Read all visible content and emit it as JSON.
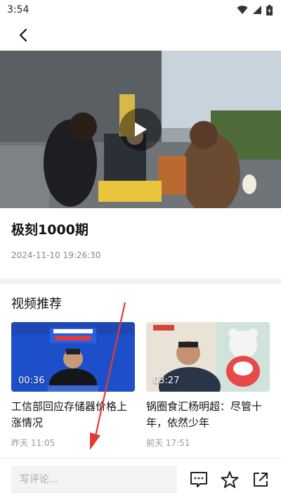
{
  "status_bar": {
    "time": "3:54"
  },
  "video": {
    "title": "极刻1000期",
    "published": "2024-11-10 19:26:30"
  },
  "recommend": {
    "section_title": "视频推荐",
    "items": [
      {
        "duration": "00:36",
        "title": "工信部回应存储器价格上涨情况",
        "time": "昨天 11:05"
      },
      {
        "duration": "03:27",
        "title": "锅圈食汇杨明超：尽管十年，依然少年",
        "time": "前天 17:51"
      }
    ]
  },
  "comment_bar": {
    "placeholder": "写评论..."
  },
  "colors": {
    "arrow": "#e53935",
    "text_primary": "#111111",
    "text_muted": "#999999"
  }
}
